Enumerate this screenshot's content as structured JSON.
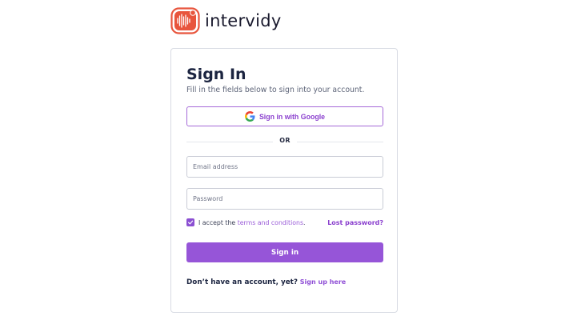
{
  "brand": {
    "name": "intervidy",
    "logo_icon": "waveform-icon",
    "accent_color": "#e8553d"
  },
  "signin": {
    "title": "Sign In",
    "subtitle": "Fill in the fields below to sign into your account.",
    "google_button": {
      "label": "Sign in with Google",
      "icon": "google-icon"
    },
    "divider_text": "OR",
    "email": {
      "value": "",
      "placeholder": "Email address"
    },
    "password": {
      "value": "",
      "placeholder": "Password"
    },
    "terms": {
      "checked": true,
      "prefix": "I accept the ",
      "link": "terms and conditions",
      "suffix": "."
    },
    "lost_password": "Lost password?",
    "submit_label": "Sign in",
    "signup_prompt": "Don’t have an account, yet?",
    "signup_link": "Sign up here"
  },
  "colors": {
    "primary": "#9655d8",
    "link": "#8a3fce",
    "text": "#1b2440",
    "border": "#d8dbe3"
  }
}
